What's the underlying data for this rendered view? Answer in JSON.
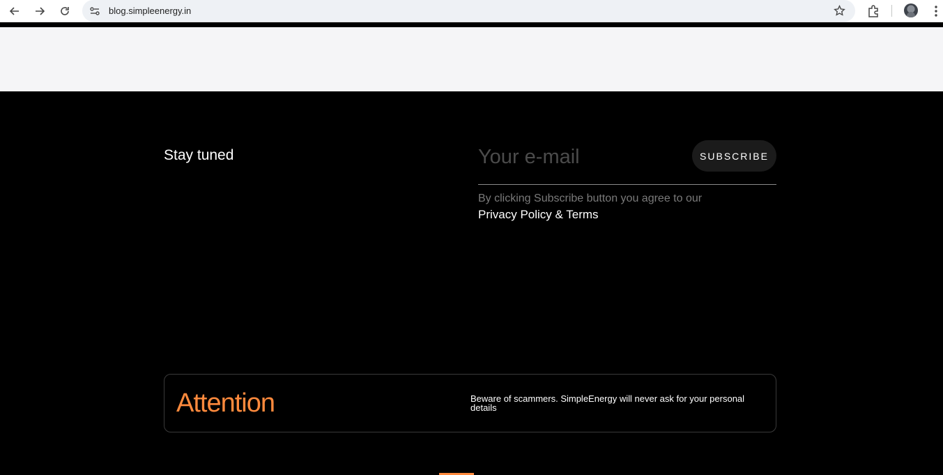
{
  "browser": {
    "url": "blog.simpleenergy.in"
  },
  "newsletter": {
    "heading": "Stay tuned",
    "email_placeholder": "Your e-mail",
    "subscribe_label": "SUBSCRIBE",
    "agree_text": "By clicking Subscribe button you agree to our",
    "policy_link": "Privacy Policy & Terms"
  },
  "attention": {
    "title": "Attention",
    "message": "Beware of scammers. SimpleEnergy will never ask for your personal details"
  },
  "colors": {
    "accent": "#ff8a3d",
    "footer_bg": "#000000",
    "top_band_bg": "#f5f5f7"
  }
}
